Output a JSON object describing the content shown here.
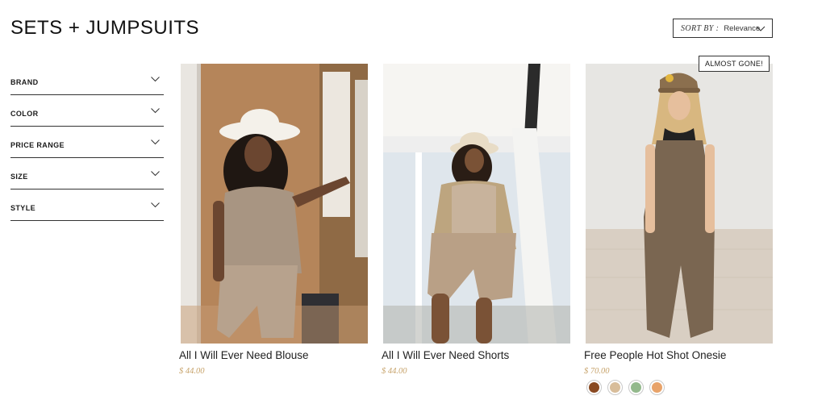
{
  "page": {
    "title": "SETS + JUMPSUITS"
  },
  "sort": {
    "label": "SORT BY :",
    "value": "Relevance"
  },
  "filters": [
    {
      "label": "BRAND"
    },
    {
      "label": "COLOR"
    },
    {
      "label": "PRICE RANGE"
    },
    {
      "label": "SIZE"
    },
    {
      "label": "STYLE"
    }
  ],
  "products": [
    {
      "title": "All I Will Ever Need Blouse",
      "price": "$ 44.00"
    },
    {
      "title": "All I Will Ever Need Shorts",
      "price": "$ 44.00"
    },
    {
      "title": "Free People Hot Shot Onesie",
      "price": "$ 70.00",
      "badge": "ALMOST GONE!",
      "swatches": [
        "#8a4a22",
        "#d8bd9a",
        "#93b98c",
        "#e8a36a"
      ]
    }
  ],
  "colors": {
    "price": "#c7a36b",
    "border": "#333333"
  }
}
